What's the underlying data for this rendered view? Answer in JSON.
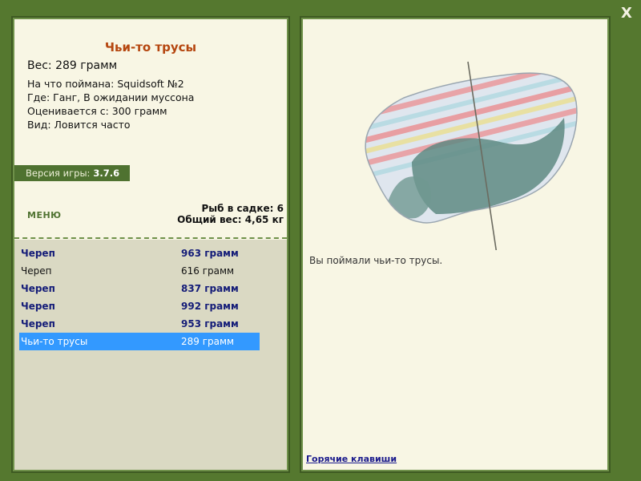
{
  "close_label": "X",
  "item": {
    "title": "Чьи-то трусы",
    "weight_line": "Вес: 289 грамм",
    "details": [
      "На что поймана: Squidsoft №2",
      "Где: Ганг, В ожидании муссона",
      "Оценивается с: 300 грамм",
      "Вид: Ловится часто"
    ]
  },
  "version": {
    "label": "Версия игры:",
    "value": "3.7.6"
  },
  "menu_label": "МЕНЮ",
  "stats": {
    "count_line": "Рыб в садке: 6",
    "total_line": "Общий вес: 4,65 кг"
  },
  "catches": [
    {
      "name": "Череп",
      "weight": "963 грамм",
      "bold": true,
      "selected": false
    },
    {
      "name": "Череп",
      "weight": "616 грамм",
      "bold": false,
      "selected": false
    },
    {
      "name": "Череп",
      "weight": "837 грамм",
      "bold": true,
      "selected": false
    },
    {
      "name": "Череп",
      "weight": "992 грамм",
      "bold": true,
      "selected": false
    },
    {
      "name": "Череп",
      "weight": "953 грамм",
      "bold": true,
      "selected": false
    },
    {
      "name": "Чьи-то трусы",
      "weight": "289 грамм",
      "bold": false,
      "selected": true
    }
  ],
  "catch_message": "Вы поймали чьи-то трусы.",
  "hotkeys_label": "Горячие клавиши",
  "colors": {
    "background": "#55782f",
    "panel": "#f8f6e4",
    "title": "#b5460f",
    "selection": "#3399ff",
    "bold_entry": "#141c78"
  }
}
